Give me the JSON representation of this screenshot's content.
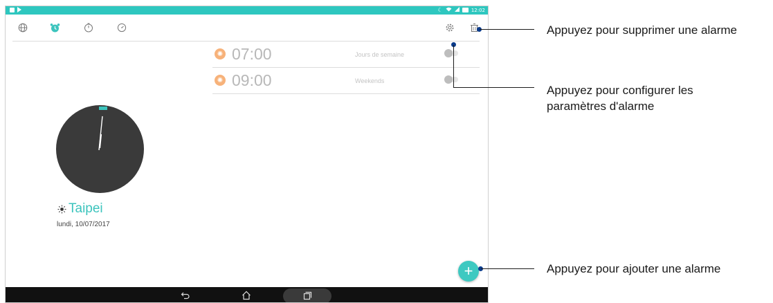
{
  "status_bar": {
    "time": "12:02",
    "left_icons": [
      "notification-square-icon",
      "play-store-icon"
    ],
    "right_icons": [
      "moon-icon",
      "wifi-icon",
      "signal-icon",
      "battery-icon"
    ]
  },
  "toolbar": {
    "tabs": [
      {
        "icon": "globe-icon",
        "label": "World clock"
      },
      {
        "icon": "alarm-icon",
        "label": "Alarm",
        "selected": true
      },
      {
        "icon": "stopwatch-icon",
        "label": "Stopwatch"
      },
      {
        "icon": "timer-icon",
        "label": "Timer"
      }
    ],
    "actions": [
      "gear-icon",
      "trash-icon"
    ]
  },
  "alarms": [
    {
      "time": "07:00",
      "days": "Jours de semaine",
      "enabled": false
    },
    {
      "time": "09:00",
      "days": "Weekends",
      "enabled": false
    }
  ],
  "clock": {
    "city": "Taipei",
    "date": "lundi, 10/07/2017"
  },
  "colors": {
    "accent": "#3cc4bd",
    "status_bar": "#2ec7bf",
    "alarm_icon": "#f7b27a",
    "clock_face": "#3a3a3a",
    "callout_dot": "#0b3c8c"
  },
  "fab": {
    "icon": "plus-icon"
  },
  "nav_bar": {
    "buttons": [
      "back-icon",
      "home-icon",
      "recents-icon"
    ]
  },
  "callouts": [
    {
      "text": "Appuyez pour supprimer une alarme"
    },
    {
      "line1": "Appuyez pour configurer les",
      "line2": "paramètres d'alarme"
    },
    {
      "text": "Appuyez pour ajouter une alarme"
    }
  ]
}
